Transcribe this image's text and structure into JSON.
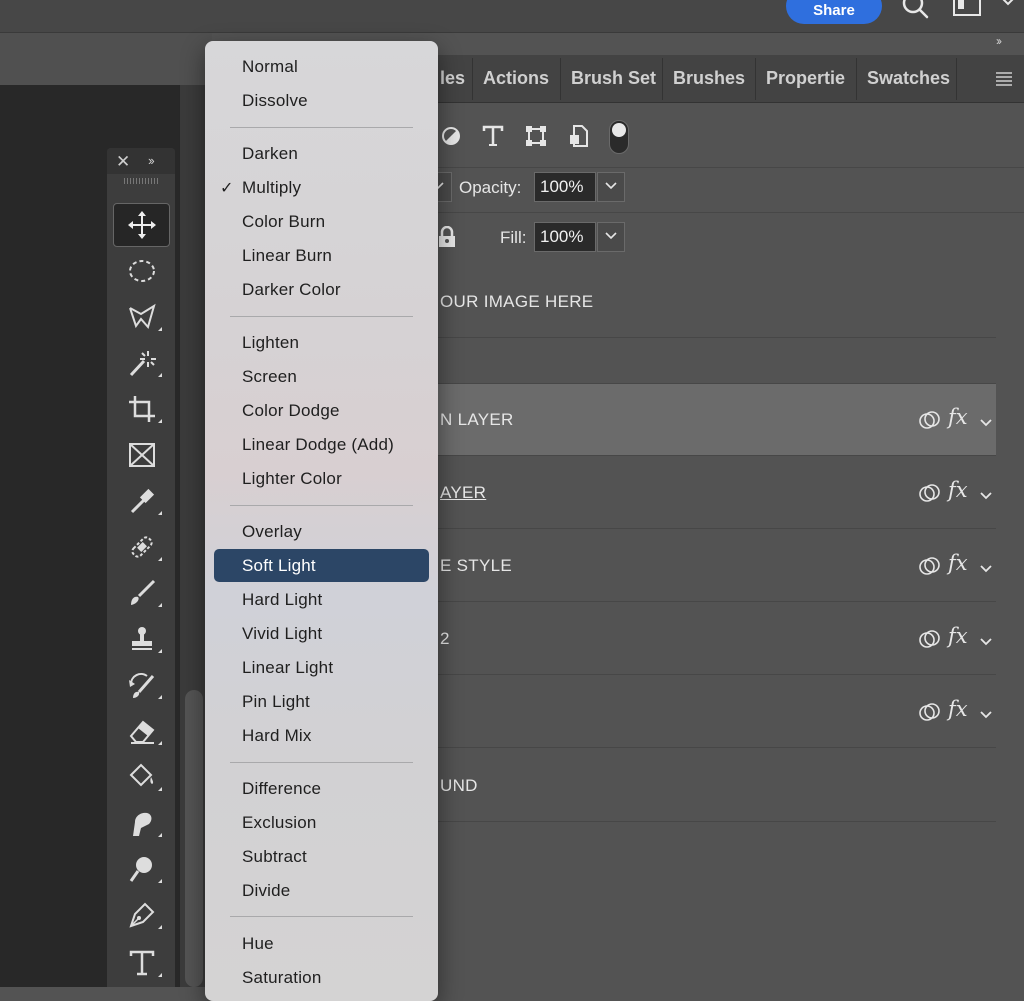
{
  "topbar": {
    "share_label": "Share"
  },
  "icons": [
    "search-icon",
    "workspace-icon",
    "chevron-down-icon",
    "close-icon",
    "expand-panels-icon",
    "panel-menu-icon"
  ],
  "tools_panel": {
    "close_glyph": "✕",
    "expand_glyph": "››",
    "tools": [
      {
        "name": "move-tool",
        "active": true
      },
      {
        "name": "marquee-tool"
      },
      {
        "name": "lasso-tool"
      },
      {
        "name": "magic-wand-tool"
      },
      {
        "name": "crop-tool"
      },
      {
        "name": "frame-tool"
      },
      {
        "name": "eyedropper-tool"
      },
      {
        "name": "healing-brush-tool"
      },
      {
        "name": "brush-tool"
      },
      {
        "name": "clone-stamp-tool"
      },
      {
        "name": "history-brush-tool"
      },
      {
        "name": "eraser-tool"
      },
      {
        "name": "paint-bucket-tool"
      },
      {
        "name": "smudge-tool"
      },
      {
        "name": "dodge-tool"
      },
      {
        "name": "pen-tool"
      },
      {
        "name": "type-tool"
      }
    ]
  },
  "panel_tabs": [
    "les",
    "Actions",
    "Brush Set",
    "Brushes",
    "Propertie",
    "Swatches"
  ],
  "panel_collapse_glyph": "››",
  "filter_icons": [
    "adjustment-filter-icon",
    "type-filter-icon",
    "shape-filter-icon",
    "smart-object-filter-icon",
    "filter-toggle"
  ],
  "layer_controls": {
    "opacity_label": "Opacity:",
    "opacity_value": "100%",
    "fill_label": "Fill:",
    "fill_value": "100%",
    "lock_icon": "lock-icon"
  },
  "layers": [
    {
      "name": "OUR IMAGE HERE",
      "fx": false
    },
    {
      "name": "",
      "fx": false
    },
    {
      "name": "N LAYER",
      "fx": true,
      "selected": true,
      "fx_label": "fx"
    },
    {
      "name": "AYER",
      "fx": true,
      "underlined": true,
      "fx_label": "fx"
    },
    {
      "name": "E STYLE",
      "fx": true,
      "fx_label": "fx"
    },
    {
      "name": "2",
      "fx": true,
      "fx_label": "fx"
    },
    {
      "name": "",
      "fx": true,
      "fx_label": "fx"
    },
    {
      "name": "UND",
      "fx": false
    }
  ],
  "blend_menu": {
    "checked": "Multiply",
    "highlighted": "Soft Light",
    "check_glyph": "✓",
    "groups": [
      [
        "Normal",
        "Dissolve"
      ],
      [
        "Darken",
        "Multiply",
        "Color Burn",
        "Linear Burn",
        "Darker Color"
      ],
      [
        "Lighten",
        "Screen",
        "Color Dodge",
        "Linear Dodge (Add)",
        "Lighter Color"
      ],
      [
        "Overlay",
        "Soft Light",
        "Hard Light",
        "Vivid Light",
        "Linear Light",
        "Pin Light",
        "Hard Mix"
      ],
      [
        "Difference",
        "Exclusion",
        "Subtract",
        "Divide"
      ],
      [
        "Hue",
        "Saturation"
      ]
    ]
  },
  "colors": {
    "accent": "#2f6fde",
    "menu_highlight": "#2c4666",
    "panel_bg": "#535353",
    "canvas_bg": "#282828"
  }
}
